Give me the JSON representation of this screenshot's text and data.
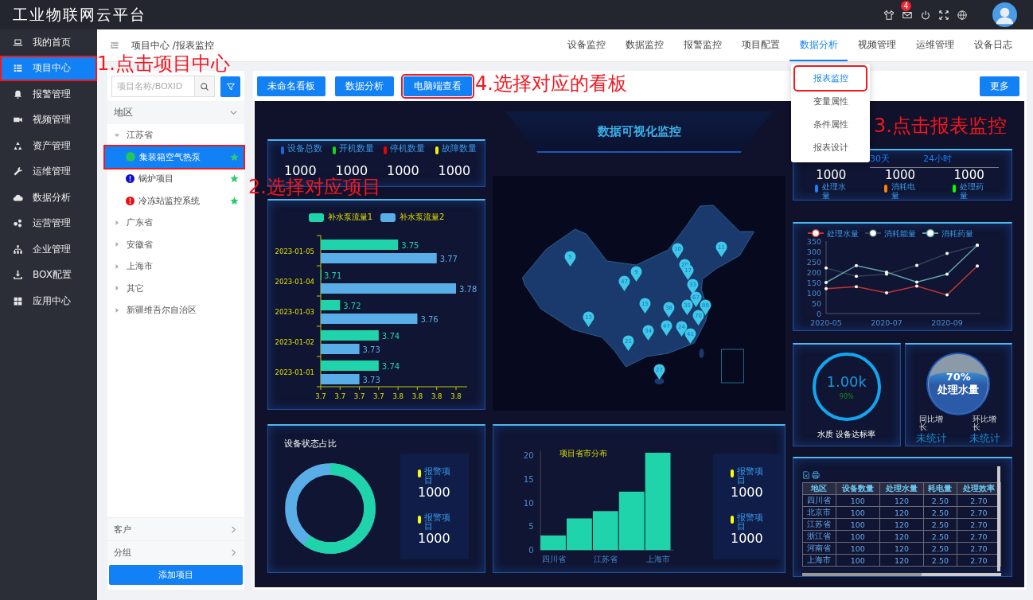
{
  "app": {
    "title": "工业物联网云平台",
    "notification_count": "4"
  },
  "sidebar": {
    "items": [
      {
        "label": "我的首页",
        "selected": false,
        "highlighted": false
      },
      {
        "label": "项目中心",
        "selected": true,
        "highlighted": true
      },
      {
        "label": "报警管理",
        "selected": false,
        "highlighted": false
      },
      {
        "label": "视频管理",
        "selected": false,
        "highlighted": false
      },
      {
        "label": "资产管理",
        "selected": false,
        "highlighted": false
      },
      {
        "label": "运维管理",
        "selected": false,
        "highlighted": false
      },
      {
        "label": "数据分析",
        "selected": false,
        "highlighted": false
      },
      {
        "label": "运营管理",
        "selected": false,
        "highlighted": false
      },
      {
        "label": "企业管理",
        "selected": false,
        "highlighted": false
      },
      {
        "label": "BOX配置",
        "selected": false,
        "highlighted": false
      },
      {
        "label": "应用中心",
        "selected": false,
        "highlighted": false
      }
    ]
  },
  "breadcrumb": "项目中心 /报表监控",
  "tabs": [
    {
      "label": "设备监控",
      "selected": false
    },
    {
      "label": "数据监控",
      "selected": false
    },
    {
      "label": "报警监控",
      "selected": false
    },
    {
      "label": "项目配置",
      "selected": false
    },
    {
      "label": "数据分析",
      "selected": true
    },
    {
      "label": "视频管理",
      "selected": false
    },
    {
      "label": "运维管理",
      "selected": false
    },
    {
      "label": "设备日志",
      "selected": false
    }
  ],
  "dropdown": {
    "items": [
      {
        "label": "报表监控",
        "selected": true,
        "highlighted": true
      },
      {
        "label": "变量属性",
        "selected": false,
        "highlighted": false
      },
      {
        "label": "条件属性",
        "selected": false,
        "highlighted": false
      },
      {
        "label": "报表设计",
        "selected": false,
        "highlighted": false
      }
    ]
  },
  "project_panel": {
    "search": {
      "placeholder": "项目名称/BOXID"
    },
    "region_header": "地区",
    "tree": [
      {
        "label": "江苏省",
        "expanded": true,
        "children": [
          {
            "label": "集装箱空气热泵",
            "kind": "online",
            "selected": true,
            "highlighted": true,
            "starred": true
          },
          {
            "label": "锅炉项目",
            "kind": "info",
            "selected": false,
            "highlighted": false,
            "starred": true
          },
          {
            "label": "冷冻站监控系统",
            "kind": "alarm",
            "selected": false,
            "highlighted": false,
            "starred": true
          }
        ]
      },
      {
        "label": "广东省",
        "expanded": false
      },
      {
        "label": "安徽省",
        "expanded": false
      },
      {
        "label": "上海市",
        "expanded": false
      },
      {
        "label": "其它",
        "expanded": false
      },
      {
        "label": "新疆维吾尔自治区",
        "expanded": false
      }
    ],
    "sections": [
      "客户",
      "分组"
    ],
    "add_button": "添加项目"
  },
  "toolbar": {
    "buttons": [
      {
        "label": "未命名看板",
        "highlighted": false
      },
      {
        "label": "数据分析",
        "highlighted": false
      },
      {
        "label": "电脑端查看",
        "highlighted": true
      }
    ],
    "more": "更多"
  },
  "dashboard": {
    "title": "数据可视化监控",
    "stats": [
      {
        "label": "设备总数",
        "value": "1000",
        "color": "#1565e8"
      },
      {
        "label": "开机数量",
        "value": "1000",
        "color": "#19d419"
      },
      {
        "label": "停机数量",
        "value": "1000",
        "color": "#f00000"
      },
      {
        "label": "故障数量",
        "value": "1000",
        "color": "#f0f000"
      }
    ],
    "flow_chart": {
      "chart_data": {
        "type": "bar",
        "orientation": "horizontal",
        "categories": [
          "2023-01-05",
          "2023-01-04",
          "2023-01-03",
          "2023-01-02",
          "2023-01-01"
        ],
        "series": [
          {
            "name": "补水泵流量1",
            "color": "#1fd3ab",
            "values": [
              3.75,
              3.71,
              3.72,
              3.74,
              3.74
            ]
          },
          {
            "name": "补水泵流量2",
            "color": "#5aaee8",
            "values": [
              3.77,
              3.78,
              3.76,
              3.73,
              3.73
            ]
          }
        ],
        "xlim": [
          3.71,
          3.78
        ],
        "xticks": [
          {
            "value": 3.71,
            "label": "3.7"
          },
          {
            "value": 3.72,
            "label": "3.7"
          },
          {
            "value": 3.73,
            "label": "3.7"
          },
          {
            "value": 3.74,
            "label": "3.7"
          },
          {
            "value": 3.75,
            "label": "3.8"
          },
          {
            "value": 3.76,
            "label": "3.8"
          },
          {
            "value": 3.77,
            "label": "3.8"
          },
          {
            "value": 3.78,
            "label": "3.8"
          }
        ],
        "data_labels": true
      }
    },
    "status_card": {
      "title": "设备状态占比",
      "legend": [
        {
          "label": "报警项目",
          "value": "1000",
          "color": "#ffff00"
        },
        {
          "label": "报警项目",
          "value": "1000",
          "color": "#ffff00"
        }
      ]
    },
    "map": {
      "markers": [
        "5",
        "10",
        "11",
        "20",
        "17",
        "9",
        "47",
        "33",
        "67",
        "35",
        "88",
        "38",
        "15",
        "70",
        "13",
        "47",
        "24",
        "34",
        "41",
        "21",
        "27"
      ]
    },
    "distribution_card": {
      "chart_data": {
        "type": "bar",
        "title": "项目省市分布",
        "categories": [
          "四川省",
          null,
          "江苏省",
          null,
          "上海市"
        ],
        "values": [
          3,
          6.5,
          8,
          12,
          20
        ],
        "color": "#1fd3ab",
        "ylim": [
          0,
          20
        ],
        "yticks": [
          {
            "value": 0,
            "label": "0"
          },
          {
            "value": 5,
            "label": "5"
          },
          {
            "value": 10,
            "label": "10"
          },
          {
            "value": 15,
            "label": "15"
          },
          {
            "value": 20,
            "label": "20"
          }
        ]
      },
      "legend": [
        {
          "label": "报警项目",
          "value": "1000",
          "color": "#ffff00"
        },
        {
          "label": "报警项目",
          "value": "1000",
          "color": "#ffff00"
        }
      ]
    },
    "period_tabs": [
      "30天",
      "24小时"
    ],
    "totals": [
      {
        "label": "处理水量",
        "value": "1000",
        "color": "#1a7fff"
      },
      {
        "label": "消耗电量",
        "value": "1000",
        "color": "#ff8000"
      },
      {
        "label": "处理药量",
        "value": "1000",
        "color": "#00ff00"
      }
    ],
    "trend_chart": {
      "chart_data": {
        "type": "line",
        "categories": [
          "2020-05",
          null,
          "2020-07",
          null,
          "2020-09",
          null
        ],
        "legend": "top",
        "ylim": [
          0,
          350
        ],
        "yticks": [
          {
            "value": 0,
            "label": "0"
          },
          {
            "value": 50,
            "label": "50"
          },
          {
            "value": 100,
            "label": "100"
          },
          {
            "value": 150,
            "label": "150"
          },
          {
            "value": 200,
            "label": "200"
          },
          {
            "value": 250,
            "label": "250"
          },
          {
            "value": 300,
            "label": "300"
          },
          {
            "value": 350,
            "label": "350"
          }
        ],
        "series": [
          {
            "name": "处理水量",
            "color": "#c23531",
            "values": [
              120,
              130,
              100,
              133,
              90,
              230
            ]
          },
          {
            "name": "消耗能量",
            "color": "#2f4554",
            "values": [
              220,
              180,
              190,
              233,
              290,
              330
            ]
          },
          {
            "name": "消耗药量",
            "color": "#61a0a8",
            "values": [
              150,
              232,
              200,
              152,
              190,
              330
            ]
          }
        ]
      }
    },
    "gauge": {
      "value": "1.00k",
      "percent": "90%",
      "label": "水质 设备达标率"
    },
    "water_ball": {
      "percent": "70%",
      "label": "处理水量",
      "level": 0.7,
      "stats": [
        {
          "label": "同比增长",
          "value": "未统计"
        },
        {
          "label": "环比增长",
          "value": "未统计"
        }
      ]
    },
    "table": {
      "columns": [
        "地区",
        "设备数量",
        "处理水量",
        "耗电量",
        "处理效率"
      ],
      "rows": [
        [
          "四川省",
          "100",
          "120",
          "2.50",
          "2.70"
        ],
        [
          "北京市",
          "100",
          "120",
          "2.50",
          "2.70"
        ],
        [
          "江苏省",
          "100",
          "120",
          "2.50",
          "2.70"
        ],
        [
          "浙江省",
          "100",
          "120",
          "2.50",
          "2.70"
        ],
        [
          "河南省",
          "100",
          "120",
          "2.50",
          "2.70"
        ],
        [
          "上海市",
          "100",
          "120",
          "2.50",
          "2.70"
        ]
      ]
    }
  },
  "annotations": [
    {
      "text": "1.点击项目中心"
    },
    {
      "text": "4.选择对应的看板"
    },
    {
      "text": "2.选择对应项目"
    },
    {
      "text": "3.点击报表监控"
    }
  ]
}
